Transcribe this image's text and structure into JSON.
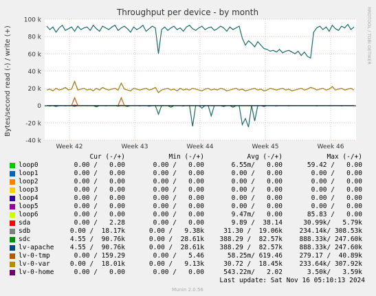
{
  "chart_data": {
    "type": "line",
    "title": "Throughput per device - by month",
    "ylabel": "Bytes/second read (-) / write (+)",
    "watermark": "RRDTOOL / TOBI OETIKER",
    "ylim": [
      -40000,
      100000
    ],
    "yticks": [
      "100 k",
      "80 k",
      "60 k",
      "40 k",
      "20 k",
      "0",
      "-20 k",
      "-40 k"
    ],
    "xticks": [
      "Week 42",
      "Week 43",
      "Week 44",
      "Week 45",
      "Week 46"
    ],
    "grid": true,
    "series": [
      {
        "name": "lv-apache",
        "color": "#1a6a6a",
        "direction": "write",
        "values": [
          92000,
          88000,
          91000,
          85000,
          90000,
          93000,
          87000,
          89000,
          91000,
          86000,
          92000,
          88000,
          90000,
          91000,
          87000,
          93000,
          89000,
          86000,
          92000,
          90000,
          88000,
          91000,
          93000,
          87000,
          90000,
          92000,
          89000,
          85000,
          91000,
          88000,
          90000,
          93000,
          86000,
          89000,
          92000,
          90000,
          60000,
          88000,
          91000,
          87000,
          90000,
          92000,
          88000,
          90000,
          86000,
          91000,
          93000,
          89000,
          87000,
          90000,
          92000,
          88000,
          90000,
          91000,
          87000,
          89000,
          92000,
          90000,
          86000,
          91000,
          88000,
          90000,
          92000,
          78000,
          70000,
          75000,
          72000,
          68000,
          74000,
          70000,
          66000,
          65000,
          63000,
          64000,
          62000,
          65000,
          61000,
          63000,
          64000,
          62000,
          60000,
          63000,
          58000,
          62000,
          57000,
          55000,
          85000,
          90000,
          92000,
          88000,
          91000,
          86000,
          93000,
          89000,
          87000,
          92000,
          90000,
          94000,
          88000,
          91000
        ]
      },
      {
        "name": "lv-var",
        "color": "#9a7a10",
        "direction": "write",
        "values": [
          18000,
          19000,
          17000,
          20000,
          18000,
          19000,
          21000,
          18000,
          19000,
          28000,
          18000,
          19000,
          20000,
          18000,
          19000,
          17000,
          20000,
          18000,
          21000,
          19000,
          18000,
          19000,
          20000,
          18000,
          26000,
          19000,
          18000,
          17000,
          20000,
          19000,
          18000,
          19000,
          20000,
          18000,
          19000,
          21000,
          15000,
          18000,
          19000,
          20000,
          18000,
          19000,
          17000,
          20000,
          18000,
          19000,
          18000,
          20000,
          19000,
          18000,
          17000,
          19000,
          20000,
          18000,
          19000,
          18000,
          20000,
          19000,
          17000,
          18000,
          19000,
          20000,
          18000,
          19000,
          17000,
          18000,
          19000,
          20000,
          18000,
          19000,
          17000,
          18000,
          20000,
          19000,
          18000,
          19000,
          20000,
          18000,
          19000,
          17000,
          18000,
          19000,
          20000,
          18000,
          19000,
          21000,
          20000,
          18000,
          19000,
          20000,
          18000,
          19000,
          22000,
          18000,
          19000,
          20000,
          18000,
          19000,
          20000,
          18000
        ]
      },
      {
        "name": "lv-apache",
        "color": "#1a6a6a",
        "direction": "read",
        "values": [
          0,
          -500,
          0,
          -1000,
          0,
          0,
          -300,
          0,
          0,
          -800,
          0,
          0,
          0,
          -200,
          0,
          0,
          -1500,
          0,
          0,
          -400,
          0,
          0,
          0,
          -600,
          0,
          0,
          -1000,
          0,
          0,
          0,
          -300,
          0,
          0,
          -700,
          0,
          0,
          -10000,
          0,
          0,
          0,
          -2000,
          0,
          0,
          0,
          -500,
          0,
          0,
          -24000,
          0,
          0,
          -3000,
          0,
          0,
          -12000,
          0,
          0,
          0,
          -1000,
          0,
          0,
          -2000,
          0,
          0,
          -22000,
          -15000,
          -25000,
          0,
          -18000,
          0,
          0,
          -1000,
          0,
          0,
          0,
          -500,
          0,
          0,
          0,
          -300,
          0,
          0,
          0,
          -200,
          0,
          0,
          0,
          0,
          -400,
          0,
          0,
          0,
          -200,
          0,
          0,
          0,
          -300,
          0,
          0,
          0,
          0
        ]
      },
      {
        "name": "sda",
        "color": "#f22020",
        "direction": "write",
        "values": [
          0,
          0,
          0,
          0,
          0,
          0,
          0,
          0,
          0,
          500,
          0,
          0,
          0,
          0,
          0,
          0,
          0,
          0,
          0,
          0,
          0,
          0,
          0,
          0,
          300,
          0,
          0,
          0,
          0,
          0,
          0,
          0,
          0,
          0,
          0,
          0,
          0,
          0,
          0,
          0,
          0,
          0,
          0,
          0,
          0,
          0,
          0,
          0,
          0,
          0,
          0,
          0,
          0,
          0,
          0,
          0,
          0,
          0,
          0,
          0,
          0,
          0,
          0,
          0,
          0,
          0,
          0,
          0,
          0,
          0,
          0,
          0,
          0,
          0,
          0,
          0,
          0,
          0,
          0,
          0,
          0,
          0,
          0,
          0,
          0,
          0,
          0,
          0,
          0,
          0,
          0,
          0,
          0,
          0,
          0,
          0,
          0,
          0,
          0,
          0
        ]
      },
      {
        "name": "lv-0-tmp",
        "color": "#c06010",
        "direction": "write",
        "values": [
          0,
          0,
          0,
          0,
          0,
          0,
          0,
          0,
          0,
          9000,
          0,
          0,
          0,
          0,
          0,
          0,
          0,
          0,
          0,
          0,
          0,
          0,
          0,
          0,
          9000,
          0,
          0,
          0,
          0,
          0,
          0,
          0,
          0,
          0,
          0,
          0,
          0,
          0,
          0,
          0,
          0,
          0,
          0,
          0,
          0,
          0,
          0,
          0,
          0,
          0,
          0,
          0,
          0,
          0,
          0,
          0,
          0,
          0,
          0,
          0,
          0,
          0,
          0,
          0,
          0,
          0,
          0,
          0,
          0,
          0,
          0,
          0,
          0,
          0,
          0,
          0,
          0,
          0,
          0,
          0,
          0,
          0,
          0,
          0,
          0,
          0,
          0,
          0,
          0,
          0,
          0,
          0,
          0,
          0,
          0,
          0,
          0,
          0,
          0,
          0
        ]
      }
    ]
  },
  "legend": {
    "headers": {
      "cur": "Cur (-/+)",
      "min": "Min (-/+)",
      "avg": "Avg (-/+)",
      "max": "Max (-/+)"
    },
    "rows": [
      {
        "name": "loop0",
        "color": "#00cc00",
        "cur": "0.00 /   0.00",
        "min": "0.00 /   0.00",
        "avg": "6.55m/   0.00",
        "max": "59.42 /   0.00"
      },
      {
        "name": "loop1",
        "color": "#0066b3",
        "cur": "0.00 /   0.00",
        "min": "0.00 /   0.00",
        "avg": "0.00 /   0.00",
        "max": "0.00 /   0.00"
      },
      {
        "name": "loop2",
        "color": "#ff8000",
        "cur": "0.00 /   0.00",
        "min": "0.00 /   0.00",
        "avg": "0.00 /   0.00",
        "max": "0.00 /   0.00"
      },
      {
        "name": "loop3",
        "color": "#ffcc00",
        "cur": "0.00 /   0.00",
        "min": "0.00 /   0.00",
        "avg": "0.00 /   0.00",
        "max": "0.00 /   0.00"
      },
      {
        "name": "loop4",
        "color": "#330099",
        "cur": "0.00 /   0.00",
        "min": "0.00 /   0.00",
        "avg": "0.00 /   0.00",
        "max": "0.00 /   0.00"
      },
      {
        "name": "loop5",
        "color": "#990099",
        "cur": "0.00 /   0.00",
        "min": "0.00 /   0.00",
        "avg": "0.00 /   0.00",
        "max": "0.00 /   0.00"
      },
      {
        "name": "loop6",
        "color": "#ccff00",
        "cur": "0.00 /   0.00",
        "min": "0.00 /   0.00",
        "avg": "9.47m/   0.00",
        "max": "85.83 /   0.00"
      },
      {
        "name": "sda",
        "color": "#ff0000",
        "cur": "0.00 /   2.28",
        "min": "0.00 /   0.00",
        "avg": "9.89 /  38.14",
        "max": "30.99k/   5.79k"
      },
      {
        "name": "sdb",
        "color": "#808080",
        "cur": "0.00 /  18.17k",
        "min": "0.00 /   9.38k",
        "avg": "31.30 /  19.06k",
        "max": "234.14k/ 308.53k"
      },
      {
        "name": "sdc",
        "color": "#008f00",
        "cur": "4.55 /  90.76k",
        "min": "0.00 /  28.61k",
        "avg": "388.29 /  82.57k",
        "max": "888.33k/ 247.60k"
      },
      {
        "name": "lv-apache",
        "color": "#00487d",
        "cur": "4.55 /  90.76k",
        "min": "0.00 /  28.61k",
        "avg": "388.29 /  82.57k",
        "max": "888.33k/ 247.60k"
      },
      {
        "name": "lv-0-tmp",
        "color": "#b35a00",
        "cur": "0.00 / 159.29",
        "min": "0.00 /   5.46",
        "avg": "58.25m/ 619.46",
        "max": "279.17 /  40.89k"
      },
      {
        "name": "lv-0-var",
        "color": "#b38f00",
        "cur": "0.00 /  18.01k",
        "min": "0.00 /   9.13k",
        "avg": "30.72 /  18.45k",
        "max": "233.64k/ 307.92k"
      },
      {
        "name": "lv-0-home",
        "color": "#6b006b",
        "cur": "0.00 /   0.00",
        "min": "0.00 /   0.00",
        "avg": "543.22m/   2.02",
        "max": "3.50k/   3.59k"
      }
    ]
  },
  "last_update": "Last update: Sat Nov 16 05:10:13 2024",
  "footer": "Munin 2.0.56"
}
